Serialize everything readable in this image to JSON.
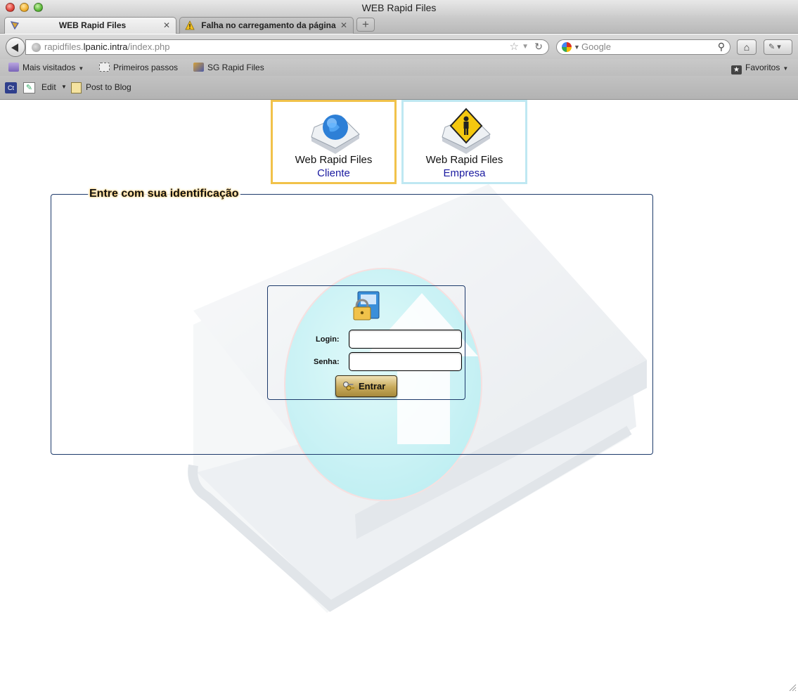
{
  "window": {
    "title": "WEB Rapid Files"
  },
  "tabs": [
    {
      "label": "WEB Rapid Files",
      "active": true
    },
    {
      "label": "Falha no carregamento da página",
      "active": false
    }
  ],
  "nav": {
    "url_prefix": "rapidfiles.",
    "url_host": "lpanic.intra",
    "url_path": "/index.php",
    "search_placeholder": "Google"
  },
  "bookmarks": {
    "items": [
      "Mais visitados",
      "Primeiros passos",
      "SG Rapid Files"
    ],
    "right": "Favoritos"
  },
  "toolbar": {
    "ct_label": "Ct",
    "edit_label": "Edit",
    "post_label": "Post to Blog"
  },
  "brands": {
    "cliente": {
      "name": "Web Rapid Files",
      "sub": "Cliente"
    },
    "empresa": {
      "name": "Web Rapid Files",
      "sub": "Empresa"
    }
  },
  "form": {
    "legend": "Entre com sua identificação",
    "login_label": "Login:",
    "senha_label": "Senha:",
    "login_value": "",
    "senha_value": "",
    "submit_label": "Entrar"
  },
  "colors": {
    "cliente_border": "#f1c24a",
    "empresa_border": "#bfe8f2",
    "frame_border": "#1d3a6b",
    "brand_sub": "#1a1aa0"
  }
}
